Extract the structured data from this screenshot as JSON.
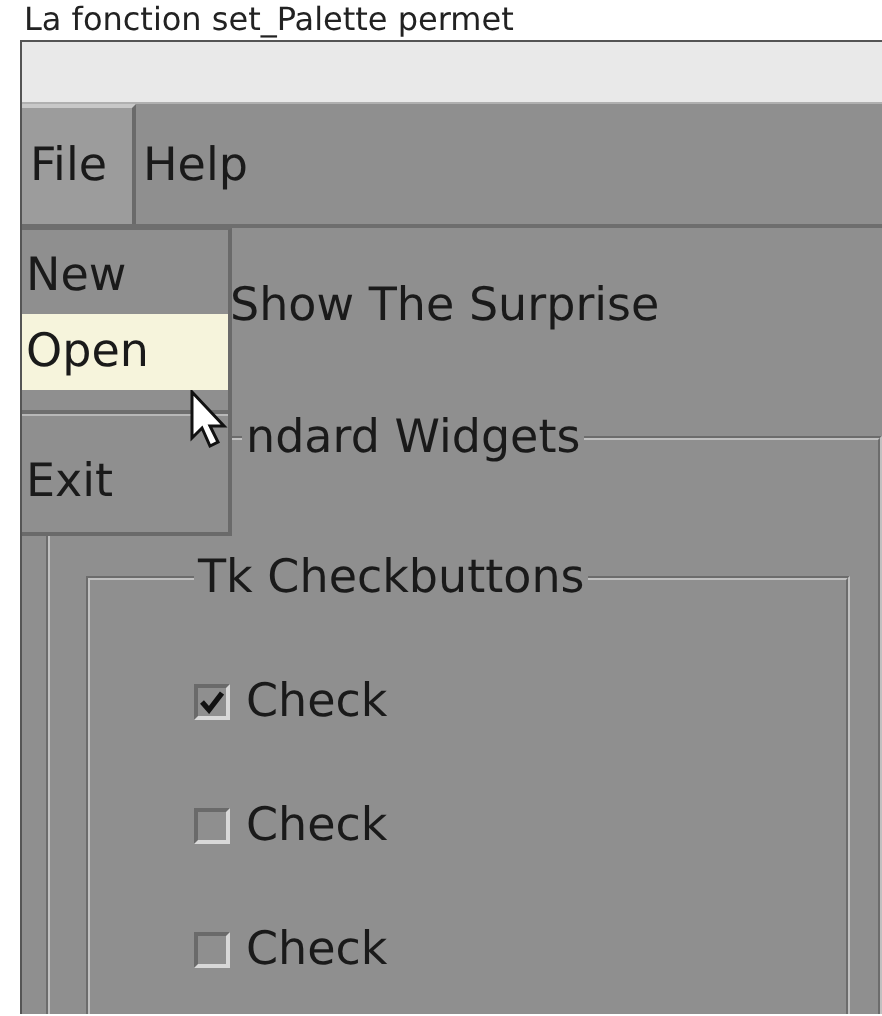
{
  "caption": "La fonction set_Palette permet",
  "menubar": [
    {
      "label": "File",
      "selected": true
    },
    {
      "label": "Help",
      "selected": false
    }
  ],
  "dropdown": [
    {
      "kind": "item",
      "label": "New",
      "selected": false
    },
    {
      "kind": "item",
      "label": "Open",
      "selected": true
    },
    {
      "kind": "separator"
    },
    {
      "kind": "item",
      "label": "Exit",
      "selected": false
    }
  ],
  "surprise_button": "Show The Surprise",
  "outer_frame": {
    "title": "ndard Widgets"
  },
  "inner_frame": {
    "title": "Tk Checkbuttons"
  },
  "checkbuttons": [
    {
      "label": "Check",
      "checked": true
    },
    {
      "label": "Check",
      "checked": false
    },
    {
      "label": "Check",
      "checked": false
    }
  ]
}
